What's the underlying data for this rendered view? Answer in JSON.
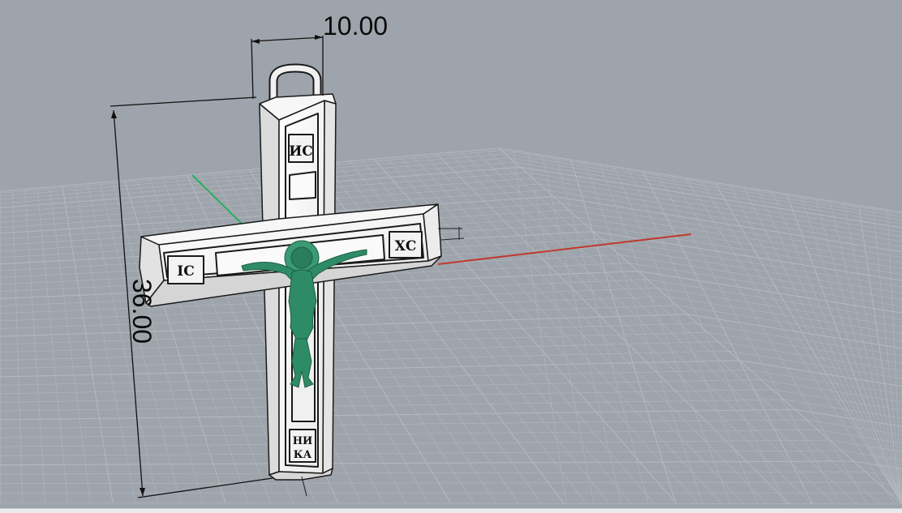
{
  "viewport": {
    "name": "Perspective",
    "background_color": "#9ea4ab",
    "grid_color": "#b3b8be",
    "x_axis_color": "#c0392b",
    "y_axis_color": "#27ae60"
  },
  "model": {
    "object": "cross pendant",
    "body_color": "#f2f2f2",
    "corpus_color": "#2e8b67",
    "inscriptions": {
      "top": "ИС",
      "left": "ІС",
      "right": "ХС",
      "bottom_line1": "НИ",
      "bottom_line2": "КА"
    }
  },
  "dimensions": {
    "width_label": "10.00",
    "height_label": "36.00"
  }
}
